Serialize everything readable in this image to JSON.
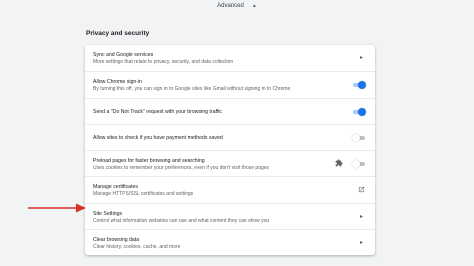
{
  "header": {
    "advanced_label": "Advanced",
    "advanced_caret": "▲"
  },
  "section": {
    "title": "Privacy and security"
  },
  "rows": [
    {
      "title": "Sync and Google services",
      "subtitle": "More settings that relate to privacy, security, and data collection",
      "control": "chevron"
    },
    {
      "title": "Allow Chrome sign-in",
      "subtitle": "By turning this off, you can sign in to Google sites like Gmail without signing in to Chrome",
      "control": "toggle",
      "toggle_on": true
    },
    {
      "title": "Send a \"Do Not Track\" request with your browsing traffic",
      "control": "toggle",
      "toggle_on": true
    },
    {
      "title": "Allow sites to check if you have payment methods saved",
      "control": "toggle",
      "toggle_on": false
    },
    {
      "title": "Preload pages for faster browsing and searching",
      "subtitle": "Uses cookies to remember your preferences, even if you don't visit those pages",
      "control": "toggle",
      "toggle_on": false,
      "extra_icon": "puzzle-piece-icon"
    },
    {
      "title": "Manage certificates",
      "subtitle": "Manage HTTPS/SSL certificates and settings",
      "control": "external-link-icon"
    },
    {
      "title": "Site Settings",
      "subtitle": "Control what information websites can use and what content they can show you",
      "control": "chevron"
    },
    {
      "title": "Clear browsing data",
      "subtitle": "Clear history, cookies, cache, and more",
      "control": "chevron"
    }
  ],
  "icons": {
    "chevron": "▸"
  },
  "colors": {
    "accent": "#1a73e8",
    "annotation_arrow": "#d93025",
    "background": "#f1f3f4"
  }
}
